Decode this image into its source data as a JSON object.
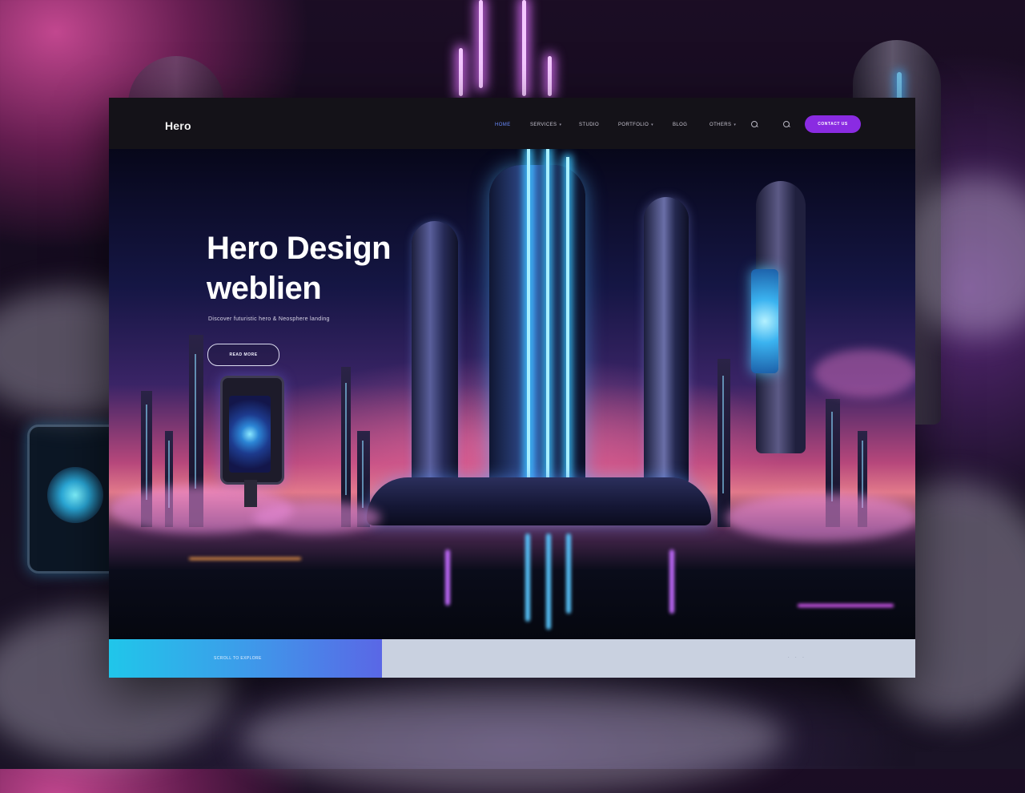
{
  "navbar": {
    "logo": "Hero",
    "items": [
      {
        "label": "HOME",
        "active": true
      },
      {
        "label": "SERVICES",
        "dropdown": true
      },
      {
        "label": "STUDIO",
        "dropdown": false
      },
      {
        "label": "PORTFOLIO",
        "dropdown": true
      },
      {
        "label": "BLOG",
        "dropdown": false
      },
      {
        "label": "OTHERS",
        "dropdown": true
      }
    ],
    "icons": [
      "search-icon",
      "search-icon"
    ],
    "cta_label": "CONTACT US"
  },
  "hero": {
    "title_line1": "Hero Design",
    "title_line2": "weblien",
    "subtitle": "Discover futuristic hero & Neosphere landing",
    "button_label": "READ MORE"
  },
  "bottom_strip": {
    "left_text": "SCROLL TO EXPLORE",
    "pager": "· · ·"
  },
  "colors": {
    "accent": "#8a2be2",
    "active_nav": "#6a8cff",
    "strip_gradient_start": "#20c6ea",
    "strip_gradient_end": "#5a67e6",
    "strip_bg": "#c9d1e0"
  }
}
